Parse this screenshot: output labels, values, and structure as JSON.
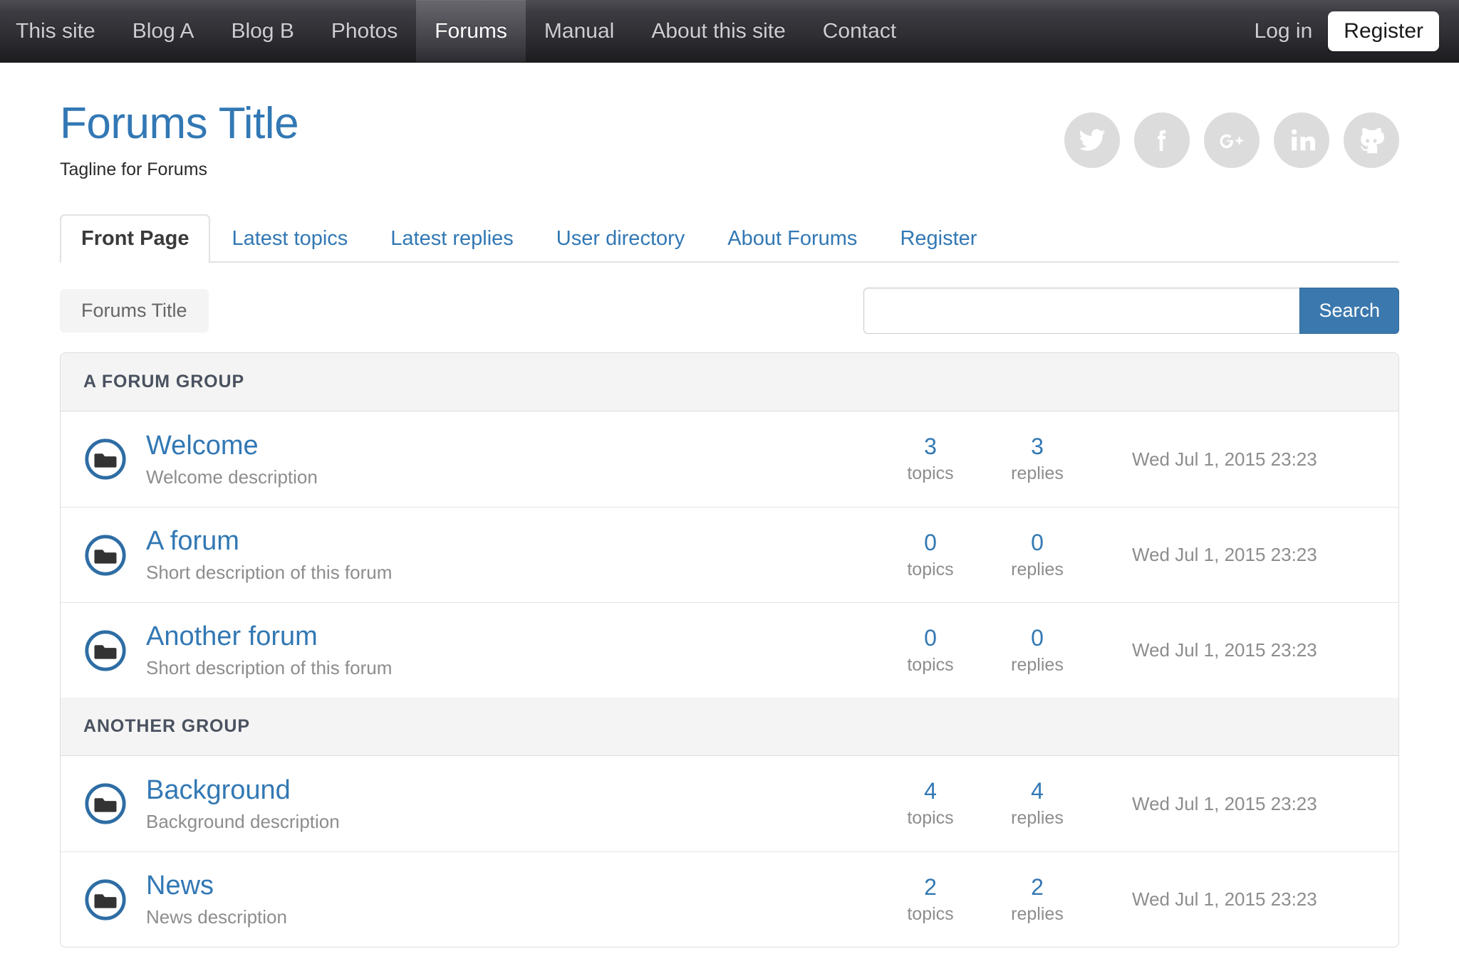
{
  "navbar": {
    "items": [
      {
        "label": "This site",
        "active": false
      },
      {
        "label": "Blog A",
        "active": false
      },
      {
        "label": "Blog B",
        "active": false
      },
      {
        "label": "Photos",
        "active": false
      },
      {
        "label": "Forums",
        "active": true
      },
      {
        "label": "Manual",
        "active": false
      },
      {
        "label": "About this site",
        "active": false
      },
      {
        "label": "Contact",
        "active": false
      }
    ],
    "login_label": "Log in",
    "register_label": "Register"
  },
  "header": {
    "title": "Forums Title",
    "tagline": "Tagline for Forums",
    "title_color": "#3278b4",
    "social": [
      {
        "name": "twitter-icon"
      },
      {
        "name": "facebook-icon"
      },
      {
        "name": "google-plus-icon"
      },
      {
        "name": "linkedin-icon"
      },
      {
        "name": "github-icon"
      }
    ]
  },
  "tabs": [
    {
      "label": "Front Page",
      "active": true
    },
    {
      "label": "Latest topics",
      "active": false
    },
    {
      "label": "Latest replies",
      "active": false
    },
    {
      "label": "User directory",
      "active": false
    },
    {
      "label": "About Forums",
      "active": false
    },
    {
      "label": "Register",
      "active": false
    }
  ],
  "utility": {
    "breadcrumb": "Forums Title",
    "search_value": "",
    "search_placeholder": "",
    "search_button": "Search",
    "search_button_color": "#3b78ae"
  },
  "forum_table": {
    "labels": {
      "topics": "topics",
      "replies": "replies"
    },
    "groups": [
      {
        "name": "A FORUM GROUP",
        "forums": [
          {
            "name": "Welcome",
            "description": "Welcome description",
            "topics": "3",
            "replies": "3",
            "last_post": "Wed Jul 1, 2015 23:23"
          },
          {
            "name": "A forum",
            "description": "Short description of this forum",
            "topics": "0",
            "replies": "0",
            "last_post": "Wed Jul 1, 2015 23:23"
          },
          {
            "name": "Another forum",
            "description": "Short description of this forum",
            "topics": "0",
            "replies": "0",
            "last_post": "Wed Jul 1, 2015 23:23"
          }
        ]
      },
      {
        "name": "ANOTHER GROUP",
        "forums": [
          {
            "name": "Background",
            "description": "Background description",
            "topics": "4",
            "replies": "4",
            "last_post": "Wed Jul 1, 2015 23:23"
          },
          {
            "name": "News",
            "description": "News description",
            "topics": "2",
            "replies": "2",
            "last_post": "Wed Jul 1, 2015 23:23"
          }
        ]
      }
    ]
  }
}
